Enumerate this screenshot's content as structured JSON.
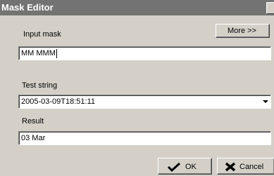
{
  "window": {
    "title": "Mask Editor"
  },
  "input_mask": {
    "label": "Input mask",
    "value": "MM MMM"
  },
  "more_button": {
    "label": "More >>"
  },
  "test_string": {
    "label": "Test string",
    "value": "2005-03-09T18:51:11"
  },
  "result": {
    "label": "Result",
    "value": "03 Mar"
  },
  "ok_button": {
    "label": "OK",
    "icon": "checkmark-icon"
  },
  "cancel_button": {
    "label": "Cancel",
    "icon": "close-x-icon"
  }
}
